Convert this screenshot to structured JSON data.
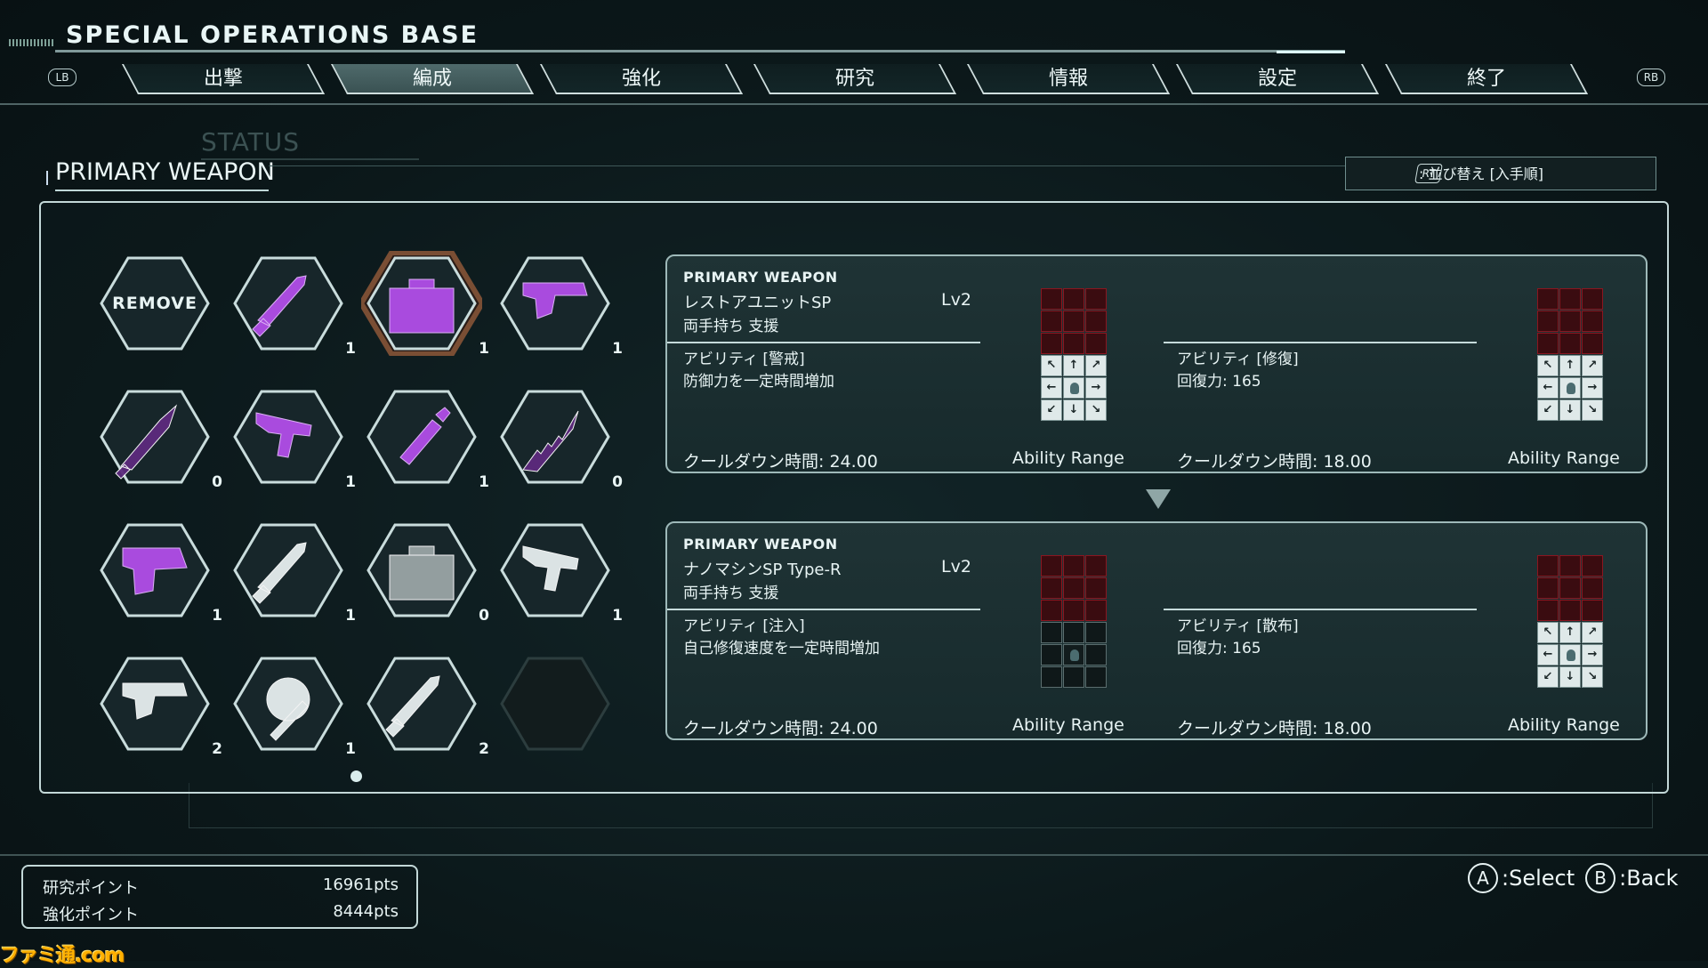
{
  "header": {
    "title": "SPECIAL OPERATIONS BASE",
    "lb": "LB",
    "rb": "RB",
    "tabs": [
      {
        "label": "出撃",
        "active": false
      },
      {
        "label": "編成",
        "active": true
      },
      {
        "label": "強化",
        "active": false
      },
      {
        "label": "研究",
        "active": false
      },
      {
        "label": "情報",
        "active": false
      },
      {
        "label": "設定",
        "active": false
      },
      {
        "label": "終了",
        "active": false
      }
    ]
  },
  "section": {
    "ghost_title": "STATUS",
    "title": "PRIMARY WEAPON",
    "sort_button": "RT",
    "sort_label": ": 並び替え [入手順]"
  },
  "inventory": {
    "remove_label": "REMOVE",
    "items": [
      {
        "icon": "remove",
        "count": "",
        "selected": false
      },
      {
        "icon": "knife-icon",
        "count": "1",
        "color": "purple",
        "selected": false
      },
      {
        "icon": "medkit-icon",
        "count": "1",
        "color": "purple",
        "selected": true
      },
      {
        "icon": "pistol-icon",
        "count": "1",
        "color": "purple",
        "selected": false
      },
      {
        "icon": "combat-knife-icon",
        "count": "0",
        "color": "purple-dim",
        "selected": false
      },
      {
        "icon": "smg-icon",
        "count": "1",
        "color": "purple",
        "selected": false
      },
      {
        "icon": "nano-syringe-icon",
        "count": "1",
        "color": "purple",
        "selected": false
      },
      {
        "icon": "serrated-blade-icon",
        "count": "0",
        "color": "purple-dim",
        "selected": false
      },
      {
        "icon": "heavy-pistol-icon",
        "count": "1",
        "color": "purple",
        "selected": false
      },
      {
        "icon": "knife-icon",
        "count": "1",
        "color": "white",
        "selected": false
      },
      {
        "icon": "repair-kit-icon",
        "count": "0",
        "color": "grey",
        "selected": false
      },
      {
        "icon": "smg-icon",
        "count": "1",
        "color": "white",
        "selected": false
      },
      {
        "icon": "pistol-icon",
        "count": "2",
        "color": "white",
        "selected": false
      },
      {
        "icon": "wrench-gear-icon",
        "count": "1",
        "color": "white",
        "selected": false
      },
      {
        "icon": "knife-icon",
        "count": "2",
        "color": "white",
        "selected": false
      },
      {
        "icon": "empty",
        "count": "",
        "selected": false
      }
    ]
  },
  "cards": [
    {
      "type": "PRIMARY WEAPON",
      "name": "レストアユニットSP",
      "level": "Lv2",
      "hand": "両手持ち 支援",
      "ability1_name": "アビリティ [警戒]",
      "ability1_desc": "防御力を一定時間増加",
      "ability1_cooldown": "クールダウン時間: 24.00",
      "ability1_range_label": "Ability Range",
      "ability1_range": "arrows",
      "ability2_name": "アビリティ [修復]",
      "ability2_desc": "回復力: 165",
      "ability2_cooldown": "クールダウン時間: 18.00",
      "ability2_range_label": "Ability Range",
      "ability2_range": "arrows"
    },
    {
      "type": "PRIMARY WEAPON",
      "name": "ナノマシンSP Type-R",
      "level": "Lv2",
      "hand": "両手持ち 支援",
      "ability1_name": "アビリティ [注入]",
      "ability1_desc": "自己修復速度を一定時間増加",
      "ability1_cooldown": "クールダウン時間: 24.00",
      "ability1_range_label": "Ability Range",
      "ability1_range": "self",
      "ability2_name": "アビリティ [散布]",
      "ability2_desc": "回復力: 165",
      "ability2_cooldown": "クールダウン時間: 18.00",
      "ability2_range_label": "Ability Range",
      "ability2_range": "arrows"
    }
  ],
  "footer": {
    "research_label": "研究ポイント",
    "research_value": "16961pts",
    "upgrade_label": "強化ポイント",
    "upgrade_value": "8444pts",
    "select_btn": "A",
    "select_label": ":Select",
    "back_btn": "B",
    "back_label": ":Back"
  },
  "watermark": "ファミ通.com",
  "colors": {
    "accent_purple": "#b14ee8",
    "panel_border": "#c3d8d8",
    "selected_border": "#8a5a3a",
    "range_red": "#8a1620"
  }
}
